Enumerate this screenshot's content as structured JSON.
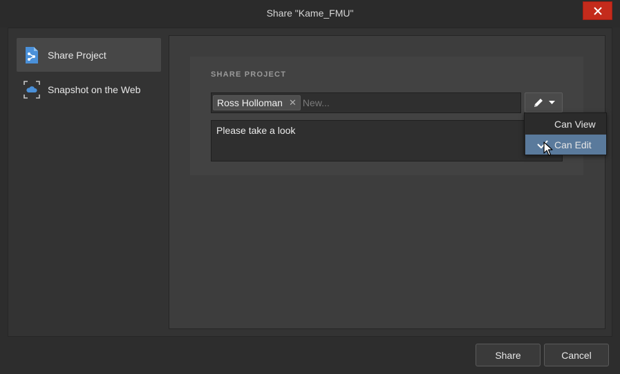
{
  "window": {
    "title": "Share \"Kame_FMU\"",
    "close_icon": "close-icon",
    "close_color": "#c42b1c"
  },
  "sidebar": {
    "items": [
      {
        "label": "Share Project",
        "icon": "share-project-icon",
        "active": true
      },
      {
        "label": "Snapshot on the Web",
        "icon": "cloud-snapshot-icon",
        "active": false
      }
    ]
  },
  "share": {
    "section_title": "SHARE PROJECT",
    "recipient_chip": "Ross Holloman",
    "chip_remove_glyph": "✕",
    "input_placeholder": "New...",
    "permission_button_icon": "pencil-icon",
    "message": "Please take a look"
  },
  "permissions_menu": {
    "options": [
      {
        "label": "Can View",
        "selected": false
      },
      {
        "label": "Can Edit",
        "selected": true
      }
    ],
    "selected_color": "#5a7a9c"
  },
  "footer": {
    "share_label": "Share",
    "cancel_label": "Cancel"
  },
  "accent": "#4a90d9"
}
